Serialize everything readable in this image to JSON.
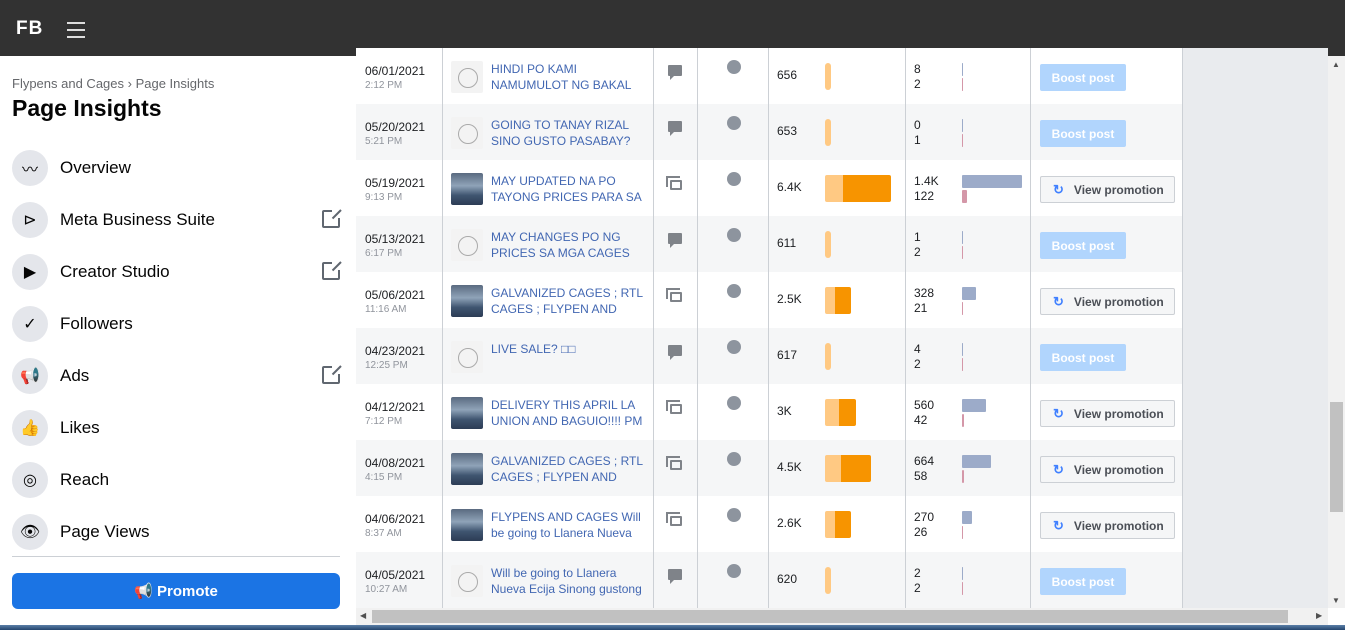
{
  "header": {
    "logo": "FB"
  },
  "sidebar": {
    "breadcrumb": "Flypens and Cages › Page Insights",
    "title": "Page Insights",
    "items": [
      {
        "label": "Overview",
        "icon": "chart-line-icon",
        "glyph": "〰",
        "external": false
      },
      {
        "label": "Meta Business Suite",
        "icon": "business-suite-icon",
        "glyph": "⊳",
        "external": true
      },
      {
        "label": "Creator Studio",
        "icon": "clapper-icon",
        "glyph": "▶",
        "external": true
      },
      {
        "label": "Followers",
        "icon": "check-calendar-icon",
        "glyph": "✓",
        "external": false
      },
      {
        "label": "Ads",
        "icon": "megaphone-icon",
        "glyph": "📢",
        "external": true
      },
      {
        "label": "Likes",
        "icon": "thumbs-up-icon",
        "glyph": "👍",
        "external": false
      },
      {
        "label": "Reach",
        "icon": "broadcast-icon",
        "glyph": "◎",
        "external": false
      },
      {
        "label": "Page Views",
        "icon": "eye-icon",
        "glyph": "👁",
        "external": false
      }
    ],
    "promote_label": "Promote"
  },
  "posts": [
    {
      "date": "06/01/2021",
      "time": "2:12 PM",
      "message": "HINDI PO KAMI NAMUMULOT NG BAKAL",
      "type": "status",
      "thumb": "logo",
      "reach": "656",
      "organic_pct": 9,
      "paid_pct": 0,
      "eng1": "8",
      "eng2": "2",
      "eng1_pct": 0,
      "eng2_pct": 0,
      "action": "Boost post"
    },
    {
      "date": "05/20/2021",
      "time": "5:21 PM",
      "message": "GOING TO TANAY RIZAL SINO GUSTO PASABAY?",
      "type": "status",
      "thumb": "logo",
      "reach": "653",
      "organic_pct": 9,
      "paid_pct": 0,
      "eng1": "0",
      "eng2": "1",
      "eng1_pct": 0,
      "eng2_pct": 0,
      "action": "Boost post"
    },
    {
      "date": "05/19/2021",
      "time": "9:13 PM",
      "message": "MAY UPDATED NA PO TAYONG PRICES PARA SA",
      "type": "album",
      "thumb": "photo",
      "reach": "6.4K",
      "organic_pct": 27,
      "paid_pct": 73,
      "eng1": "1.4K",
      "eng2": "122",
      "eng1_pct": 100,
      "eng2_pct": 8,
      "action": "View promotion"
    },
    {
      "date": "05/13/2021",
      "time": "6:17 PM",
      "message": "MAY CHANGES PO NG PRICES SA MGA CAGES",
      "type": "status",
      "thumb": "logo",
      "reach": "611",
      "organic_pct": 9,
      "paid_pct": 0,
      "eng1": "1",
      "eng2": "2",
      "eng1_pct": 0,
      "eng2_pct": 0,
      "action": "Boost post"
    },
    {
      "date": "05/06/2021",
      "time": "11:16 AM",
      "message": "GALVANIZED CAGES ; RTL CAGES ; FLYPEN AND",
      "type": "album",
      "thumb": "photo",
      "reach": "2.5K",
      "organic_pct": 15,
      "paid_pct": 24,
      "eng1": "328",
      "eng2": "21",
      "eng1_pct": 23,
      "eng2_pct": 0,
      "action": "View promotion"
    },
    {
      "date": "04/23/2021",
      "time": "12:25 PM",
      "message": "LIVE SALE? □□",
      "type": "status",
      "thumb": "logo",
      "reach": "617",
      "organic_pct": 9,
      "paid_pct": 0,
      "eng1": "4",
      "eng2": "2",
      "eng1_pct": 0,
      "eng2_pct": 0,
      "action": "Boost post"
    },
    {
      "date": "04/12/2021",
      "time": "7:12 PM",
      "message": "DELIVERY THIS APRIL LA UNION AND BAGUIO!!!! PM",
      "type": "album",
      "thumb": "photo",
      "reach": "3K",
      "organic_pct": 21,
      "paid_pct": 26,
      "eng1": "560",
      "eng2": "42",
      "eng1_pct": 40,
      "eng2_pct": 3,
      "action": "View promotion"
    },
    {
      "date": "04/08/2021",
      "time": "4:15 PM",
      "message": "GALVANIZED CAGES ; RTL CAGES ; FLYPEN AND",
      "type": "album",
      "thumb": "photo",
      "reach": "4.5K",
      "organic_pct": 24,
      "paid_pct": 45,
      "eng1": "664",
      "eng2": "58",
      "eng1_pct": 48,
      "eng2_pct": 4,
      "action": "View promotion"
    },
    {
      "date": "04/06/2021",
      "time": "8:37 AM",
      "message": "FLYPENS AND CAGES Will be going to Llanera Nueva",
      "type": "album",
      "thumb": "photo",
      "reach": "2.6K",
      "organic_pct": 15,
      "paid_pct": 24,
      "eng1": "270",
      "eng2": "26",
      "eng1_pct": 17,
      "eng2_pct": 0,
      "action": "View promotion"
    },
    {
      "date": "04/05/2021",
      "time": "10:27 AM",
      "message": "Will be going to Llanera Nueva Ecija Sinong gustong",
      "type": "status",
      "thumb": "logo",
      "reach": "620",
      "organic_pct": 9,
      "paid_pct": 0,
      "eng1": "2",
      "eng2": "2",
      "eng1_pct": 0,
      "eng2_pct": 0,
      "action": "Boost post"
    }
  ],
  "colors": {
    "accent": "#1b74e4",
    "organic": "#ffc983",
    "paid": "#f79400",
    "eng_blue": "#9cabc9",
    "eng_pink": "#d497a8",
    "boost": "#b1d5fd"
  }
}
